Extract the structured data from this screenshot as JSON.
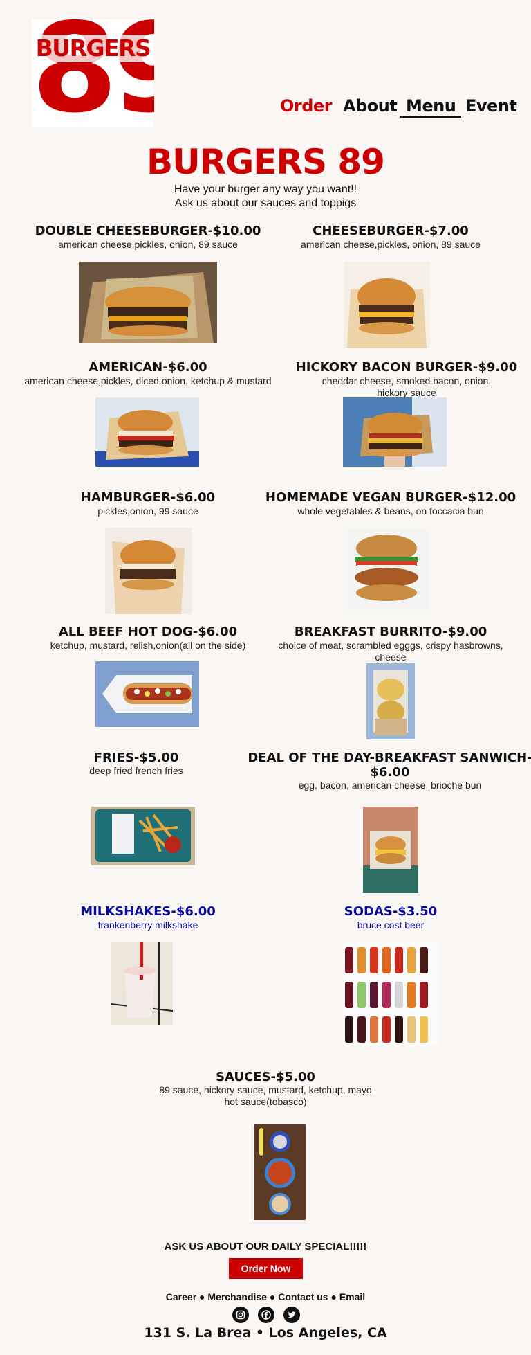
{
  "logo": {
    "number": "89",
    "word": "BURGERS"
  },
  "nav": {
    "order": "Order",
    "about": "About",
    "menu": "Menu",
    "event": "Event"
  },
  "hero": {
    "title": "BURGERS 89",
    "tagline_1": "Have your burger any way you want!!",
    "tagline_2": "Ask us about our sauces and toppigs"
  },
  "menu": [
    {
      "name": "DOUBLE CHEESEBURGER-$10.00",
      "desc": "american cheese,pickles, onion, 89 sauce"
    },
    {
      "name": "CHEESEBURGER-$7.00",
      "desc": "american cheese,pickles, onion, 89 sauce"
    },
    {
      "name": "AMERICAN-$6.00",
      "desc": "american cheese,pickles, diced onion, ketchup & mustard"
    },
    {
      "name": "HICKORY BACON BURGER-$9.00",
      "desc_1": "cheddar cheese, smoked bacon, onion,",
      "desc_2": "hickory sauce"
    },
    {
      "name": "HAMBURGER-$6.00",
      "desc": "pickles,onion, 99 sauce"
    },
    {
      "name": "HOMEMADE VEGAN BURGER-$12.00",
      "desc": "whole vegetables & beans, on foccacia bun"
    },
    {
      "name": "ALL BEEF HOT DOG-$6.00",
      "desc": "ketchup, mustard, relish,onion(all on the side)"
    },
    {
      "name": "BREAKFAST BURRITO-$9.00",
      "desc_1": "choice of meat, scrambled egggs, crispy hasbrowns,",
      "desc_2": "cheese"
    },
    {
      "name": "FRIES-$5.00",
      "desc": "deep fried french fries"
    },
    {
      "name_1": "DEAL OF THE DAY-BREAKFAST SANWICH-",
      "name_2": "$6.00",
      "desc": "egg, bacon, american cheese, brioche bun"
    },
    {
      "name": "MILKSHAKES-$6.00",
      "desc": "frankenberry milkshake"
    },
    {
      "name": "SODAS-$3.50",
      "desc": "bruce cost beer"
    },
    {
      "name": "SAUCES-$5.00",
      "desc_1": "89 sauce, hickory sauce, mustard, ketchup, mayo",
      "desc_2": "hot sauce(tobasco)"
    }
  ],
  "footer": {
    "special": "ASK US ABOUT OUR DAILY SPECIAL!!!!!",
    "order_button": "Order Now",
    "links": [
      "Career",
      "Merchandise",
      "Contact us",
      "Email"
    ],
    "address": "131 S. La Brea • Los Angeles, CA"
  },
  "colors": {
    "brand_red": "#cc0000",
    "accent_blue": "#0a0ea0",
    "background": "#faf6f4"
  },
  "icons": [
    "instagram-icon",
    "facebook-icon",
    "twitter-icon"
  ]
}
